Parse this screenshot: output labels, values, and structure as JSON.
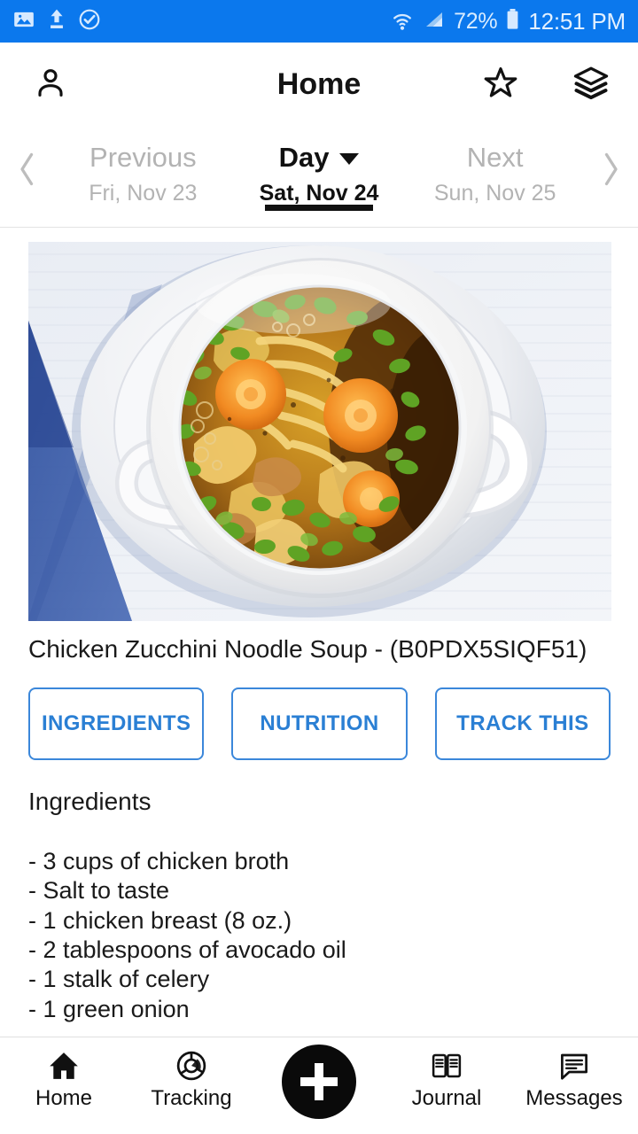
{
  "status_bar": {
    "background_color": "#0b78ed",
    "left_icons": [
      {
        "name": "image-icon",
        "label": "image"
      },
      {
        "name": "upload-icon",
        "label": "upload"
      },
      {
        "name": "check-circle-icon",
        "label": "check-circle"
      }
    ],
    "wifi_icon": "wifi-icon",
    "signal_icon": "cellular-signal-icon",
    "battery_percent": "72%",
    "battery_icon": "battery-icon",
    "time": "12:51 PM"
  },
  "header": {
    "title": "Home",
    "profile_icon": "profile-icon",
    "favorite_icon": "star-icon",
    "layers_icon": "layers-icon"
  },
  "date_nav": {
    "prev_arrow_icon": "chevron-left-icon",
    "next_arrow_icon": "chevron-right-icon",
    "previous": {
      "label": "Previous",
      "date": "Fri, Nov 23"
    },
    "current": {
      "label": "Day",
      "date": "Sat, Nov 24",
      "caret_icon": "chevron-down-icon"
    },
    "next": {
      "label": "Next",
      "date": "Sun, Nov 25"
    }
  },
  "recipe": {
    "image_alt": "chicken noodle soup in a white cup on a saucer",
    "title": "Chicken Zucchini Noodle Soup - (B0PDX5SIQF51)",
    "buttons": [
      {
        "label": "INGREDIENTS",
        "name": "ingredients-button"
      },
      {
        "label": "NUTRITION",
        "name": "nutrition-button"
      },
      {
        "label": "TRACK THIS",
        "name": "track-this-button"
      }
    ],
    "accent_color": "#2a7fd4",
    "section_heading": "Ingredients",
    "ingredients": [
      "- 3 cups of chicken broth",
      "- Salt to taste",
      "- 1 chicken breast (8 oz.)",
      "- 2 tablespoons of avocado oil",
      "- 1 stalk of celery",
      "- 1 green onion"
    ]
  },
  "bottom_nav": {
    "items": [
      {
        "label": "Home",
        "icon": "home-icon"
      },
      {
        "label": "Tracking",
        "icon": "donut-chart-icon"
      },
      {
        "label": "Journal",
        "icon": "book-icon"
      },
      {
        "label": "Messages",
        "icon": "chat-bubble-icon"
      }
    ],
    "fab": {
      "icon": "plus-icon",
      "color": "#0a0a0a"
    }
  }
}
